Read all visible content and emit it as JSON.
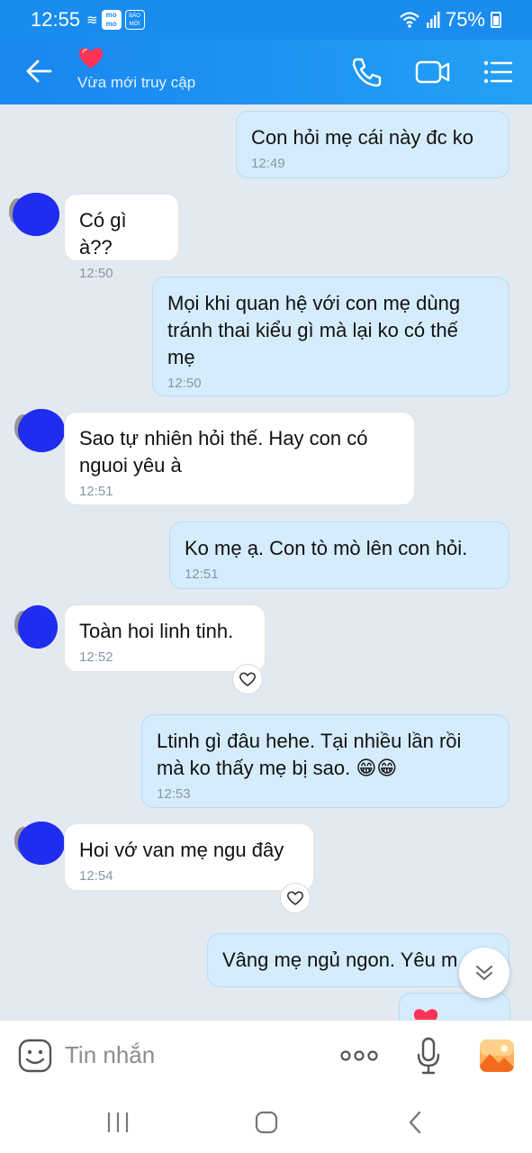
{
  "status_bar": {
    "time": "12:55",
    "battery": "75%",
    "app_icons": [
      "momo-icon",
      "baomoi-icon"
    ]
  },
  "header": {
    "subtitle": "Vừa mới truy cập",
    "title_icon": "heart-icon",
    "accent_color": "#1a8cf0"
  },
  "messages": [
    {
      "dir": "out",
      "text": "Con hỏi mẹ cái này đc ko",
      "time": "12:49"
    },
    {
      "dir": "in",
      "text": "Có gì à??",
      "time": "12:50"
    },
    {
      "dir": "out",
      "text": "Mọi khi quan hệ với con mẹ dùng\ntránh thai kiểu gì mà lại ko có thế\nmẹ",
      "time": "12:50"
    },
    {
      "dir": "in",
      "text": "Sao tự nhiên hỏi thế. Hay con có\nnguoi yêu à",
      "time": "12:51"
    },
    {
      "dir": "out",
      "text": "Ko mẹ ạ. Con tò mò lên con hỏi.",
      "time": "12:51"
    },
    {
      "dir": "in",
      "text": "Toàn hoi linh tinh.",
      "time": "12:52"
    },
    {
      "dir": "out",
      "text": "Ltinh gì đâu hehe. Tại nhiều lần rồi\nmà ko thấy mẹ bị sao. 😁😁",
      "time": "12:53"
    },
    {
      "dir": "in",
      "text": "Hoi vớ van mẹ ngu đây",
      "time": "12:54"
    },
    {
      "dir": "out",
      "text": "Vâng mẹ ngủ ngon. Yêu m",
      "time": ""
    }
  ],
  "input": {
    "placeholder": "Tin nhắn"
  }
}
